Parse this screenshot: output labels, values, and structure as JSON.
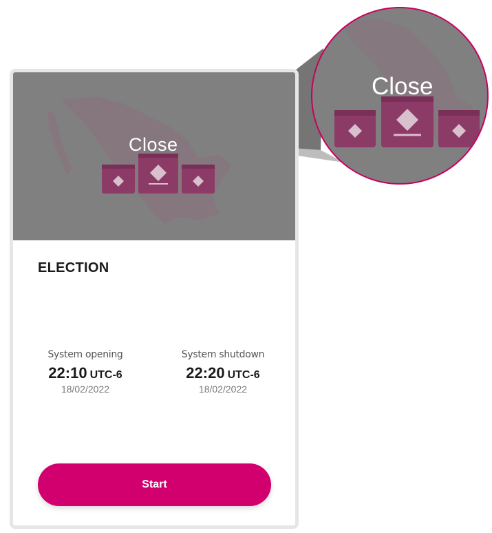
{
  "banner": {
    "status_label": "Close",
    "icon": "ballot-boxes-icon",
    "map_icon": "mexico-map-icon"
  },
  "zoom": {
    "status_label": "Close"
  },
  "election": {
    "title": "ELECTION"
  },
  "schedule": {
    "opening": {
      "caption": "System opening",
      "time": "22:10",
      "timezone": "UTC-6",
      "date": "18/02/2022"
    },
    "shutdown": {
      "caption": "System shutdown",
      "time": "22:20",
      "timezone": "UTC-6",
      "date": "18/02/2022"
    }
  },
  "actions": {
    "start_label": "Start"
  },
  "colors": {
    "accent": "#d2006e",
    "ballot": "#8c3a66",
    "banner_overlay": "#808080"
  }
}
